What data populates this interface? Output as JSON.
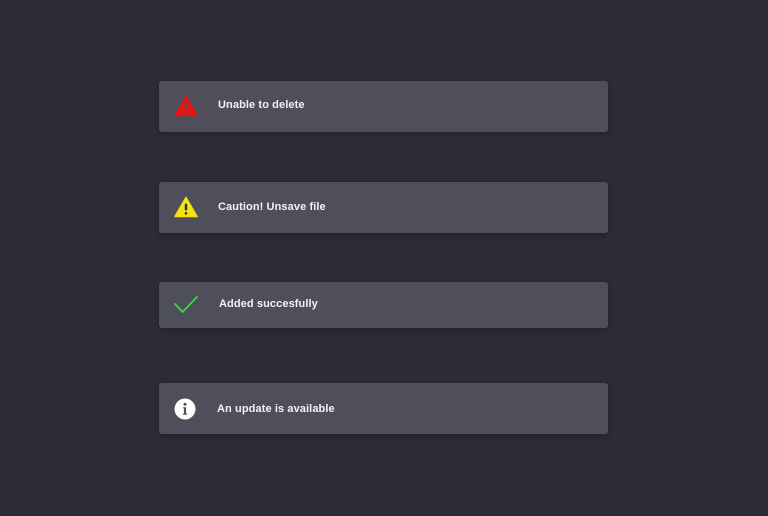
{
  "notifications": [
    {
      "type": "error",
      "message": "Unable to delete",
      "icon": "error-triangle-icon",
      "icon_color": "#e8140f"
    },
    {
      "type": "warning",
      "message": "Caution! Unsave file",
      "icon": "warning-triangle-icon",
      "icon_color": "#f6e30f"
    },
    {
      "type": "success",
      "message": "Added succesfully",
      "icon": "checkmark-icon",
      "icon_color": "#3dd83d"
    },
    {
      "type": "info",
      "message": "An update is available",
      "icon": "info-circle-icon",
      "icon_color": "#ffffff"
    }
  ],
  "colors": {
    "background": "#2c2c37",
    "toast_background": "#4f4f5c",
    "text": "#f2f2f5"
  }
}
